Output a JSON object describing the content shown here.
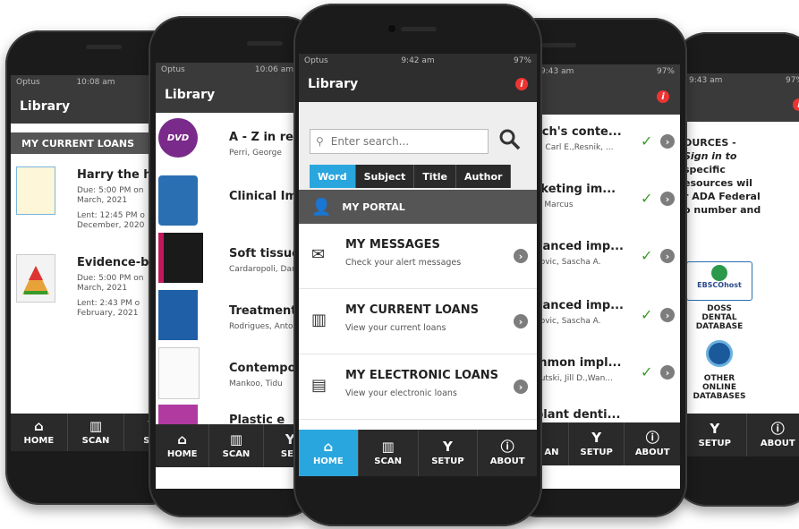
{
  "phone1": {
    "carrier": "Optus",
    "time": "10:08 am",
    "app_title": "Library",
    "section": "MY CURRENT LOANS",
    "items": [
      {
        "title": "Harry the hy",
        "due1": "Due: 5:00 PM on",
        "due2": "March, 2021",
        "lent1": "Lent: 12:45 PM o",
        "lent2": "December, 2020"
      },
      {
        "title": "Evidence-ba",
        "due1": "Due: 5:00 PM on",
        "due2": "March, 2021",
        "lent1": "Lent: 2:43 PM o",
        "lent2": "February, 2021"
      }
    ],
    "tabs": [
      {
        "label": "HOME",
        "icon": "home-icon"
      },
      {
        "label": "SCAN",
        "icon": "barcode-icon"
      },
      {
        "label": "SET",
        "icon": "wrench-icon"
      }
    ]
  },
  "phone2": {
    "carrier": "Optus",
    "time": "10:06 am",
    "app_title": "Library",
    "items": [
      {
        "title": "A - Z in res",
        "author": "Perri, George"
      },
      {
        "title": "Clinical Imp",
        "author": ""
      },
      {
        "title": "Soft tissues",
        "author": "Cardaropoli, Dar"
      },
      {
        "title": "Treatment",
        "author": "Rodrigues, Anton"
      },
      {
        "title": "Contempor",
        "author": "Mankoo, Tidu"
      },
      {
        "title": "Plastic e",
        "author": ""
      }
    ],
    "thumb_labels": {
      "dvd": "DVD"
    },
    "tabs": [
      {
        "label": "HOME",
        "icon": "home-icon"
      },
      {
        "label": "SCAN",
        "icon": "barcode-icon"
      },
      {
        "label": "SET",
        "icon": "wrench-icon"
      }
    ]
  },
  "phone3": {
    "carrier": "Optus",
    "time": "9:42 am",
    "battery": "97%",
    "app_title": "Library",
    "search": {
      "placeholder": "Enter search..."
    },
    "segments": [
      "Word",
      "Subject",
      "Title",
      "Author"
    ],
    "selected_segment": "Word",
    "portal_label": "MY PORTAL",
    "portal_items": [
      {
        "title": "MY MESSAGES",
        "subtitle": "Check your alert messages",
        "icon": "envelope-icon"
      },
      {
        "title": "MY CURRENT LOANS",
        "subtitle": "View your current loans",
        "icon": "books-icon"
      },
      {
        "title": "MY ELECTRONIC LOANS",
        "subtitle": "View your electronic loans",
        "icon": "document-icon"
      }
    ],
    "tabs": [
      {
        "label": "HOME",
        "icon": "home-icon"
      },
      {
        "label": "SCAN",
        "icon": "barcode-icon"
      },
      {
        "label": "SETUP",
        "icon": "wrench-icon"
      },
      {
        "label": "ABOUT",
        "icon": "info-icon"
      }
    ],
    "active_tab": "HOME"
  },
  "phone4": {
    "time": "9:43 am",
    "battery": "97%",
    "items": [
      {
        "title": "sch's conte...",
        "author": "h, Carl E.,Resnik, ..."
      },
      {
        "title": "rketing im...",
        "author": "s, Marcus"
      },
      {
        "title": "vanced imp...",
        "author": "novic, Sascha A."
      },
      {
        "title": "vanced imp...",
        "author": "novic, Sascha A."
      },
      {
        "title": "mmon impl...",
        "author": "hutski, Jill D.,Wan..."
      },
      {
        "title": "plant denti...",
        "author": ""
      }
    ],
    "tabs": [
      {
        "label": "AN",
        "icon": "barcode-icon"
      },
      {
        "label": "SETUP",
        "icon": "wrench-icon"
      },
      {
        "label": "ABOUT",
        "icon": "info-icon"
      }
    ]
  },
  "phone5": {
    "time": "9:43 am",
    "battery": "97%",
    "text_lines": [
      "OURCES -",
      "Sign in to",
      "specific",
      "esources wil",
      "r ADA Federal",
      "o number and"
    ],
    "databases": [
      {
        "logo": "EBSCOhost",
        "label1": "DOSS",
        "label2": "DENTAL",
        "label3": "DATABASE"
      },
      {
        "label1": "OTHER",
        "label2": "ONLINE",
        "label3": "DATABASES"
      }
    ],
    "tabs": [
      {
        "label": "SETUP",
        "icon": "wrench-icon"
      },
      {
        "label": "ABOUT",
        "icon": "info-icon"
      }
    ]
  },
  "colors": {
    "accent": "#2aa6de",
    "check": "#3a9a2a",
    "info_red": "#e33333",
    "bar": "#3a3a3a"
  }
}
